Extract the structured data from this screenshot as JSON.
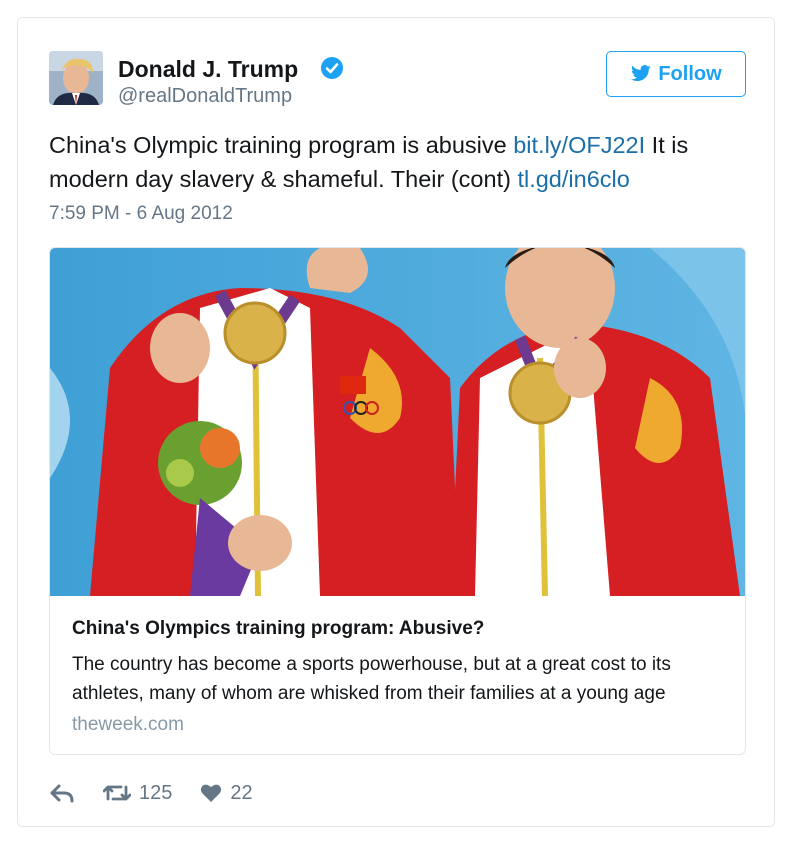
{
  "user": {
    "name": "Donald J. Trump",
    "handle": "@realDonaldTrump",
    "verified_icon": "verified-badge-icon"
  },
  "follow_button": {
    "label": "Follow",
    "icon": "twitter-bird-icon"
  },
  "tweet": {
    "text_1": "China's Olympic training program is abusive ",
    "link_1": "bit.ly/OFJ22I",
    "text_2": " It is modern day slavery & shameful. Their (cont) ",
    "link_2": "tl.gd/in6clo",
    "timestamp": "7:59 PM - 6 Aug 2012"
  },
  "card": {
    "image": "two-athletes-with-gold-medals",
    "title": "China's Olympics training program: Abusive?",
    "description": "The country has become a sports powerhouse, but at a great cost to its athletes, many of whom are whisked from their families at a young age",
    "domain": "theweek.com"
  },
  "actions": {
    "reply_icon": "reply-icon",
    "retweet_icon": "retweet-icon",
    "retweet_count": "125",
    "like_icon": "heart-icon",
    "like_count": "22"
  },
  "colors": {
    "accent": "#1da1f2",
    "link": "#1b6fa8",
    "muted": "#657786",
    "border": "#e1e8ed"
  }
}
